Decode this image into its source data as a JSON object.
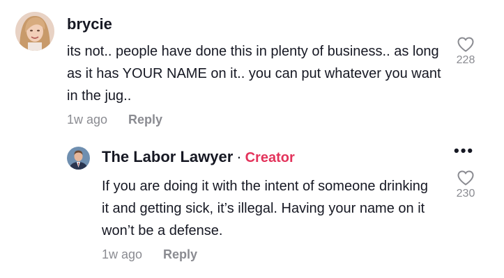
{
  "comment": {
    "username": "brycie",
    "text": "its not.. people have done this in plenty of business.. as long as it has YOUR NAME on it.. you can put whatever you want in the jug..",
    "time": "1w ago",
    "reply_label": "Reply",
    "like_count": "228",
    "like_icon": "heart-outline-icon"
  },
  "reply": {
    "username": "The Labor Lawyer",
    "separator": "·",
    "badge": "Creator",
    "text": "If you are doing it with the intent of someone drinking it and getting sick, it’s illegal. Having your name on it won’t be a defense.",
    "time": "1w ago",
    "reply_label": "Reply",
    "like_count": "230",
    "like_icon": "heart-outline-icon",
    "more_icon": "more-dots-icon",
    "more_glyph": "•••"
  },
  "colors": {
    "creator_badge": "#e3335b",
    "muted": "#8a8b91",
    "text": "#161823"
  }
}
